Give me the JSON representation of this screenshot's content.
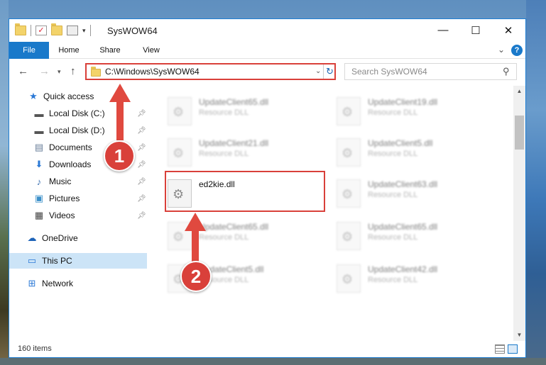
{
  "window": {
    "title": "SysWOW64",
    "controls": {
      "minimize": "—",
      "maximize": "☐",
      "close": "✕"
    }
  },
  "ribbon": {
    "tabs": [
      "File",
      "Home",
      "Share",
      "View"
    ],
    "help": "?"
  },
  "address": {
    "path": "C:\\Windows\\SysWOW64",
    "search_placeholder": "Search SysWOW64"
  },
  "nav": {
    "items": [
      {
        "label": "Quick access",
        "icon": "star-icon"
      },
      {
        "label": "Local Disk (C:)",
        "icon": "drive-icon",
        "pinned": true
      },
      {
        "label": "Local Disk (D:)",
        "icon": "drive-icon",
        "pinned": true
      },
      {
        "label": "Documents",
        "icon": "documents-icon",
        "pinned": true
      },
      {
        "label": "Downloads",
        "icon": "download-icon",
        "pinned": true
      },
      {
        "label": "Music",
        "icon": "music-icon",
        "pinned": true
      },
      {
        "label": "Pictures",
        "icon": "pictures-icon",
        "pinned": true
      },
      {
        "label": "Videos",
        "icon": "videos-icon",
        "pinned": true
      },
      {
        "label": "OneDrive",
        "icon": "cloud-icon"
      },
      {
        "label": "This PC",
        "icon": "computer-icon",
        "selected": true
      },
      {
        "label": "Network",
        "icon": "network-icon"
      }
    ]
  },
  "files": [
    {
      "name": "UpdateClient65.dll",
      "type": "Resource DLL",
      "blurred": true
    },
    {
      "name": "UpdateClient19.dll",
      "type": "Resource DLL",
      "blurred": true
    },
    {
      "name": "UpdateClient21.dll",
      "type": "Resource DLL",
      "blurred": true
    },
    {
      "name": "UpdateClient5.dll",
      "type": "Resource DLL",
      "blurred": true
    },
    {
      "name": "ed2kie.dll",
      "type": "",
      "blurred": false
    },
    {
      "name": "UpdateClient63.dll",
      "type": "Resource DLL",
      "blurred": true
    },
    {
      "name": "UpdateClient65.dll",
      "type": "Resource DLL",
      "blurred": true
    },
    {
      "name": "UpdateClient65.dll",
      "type": "Resource DLL",
      "blurred": true
    },
    {
      "name": "UpdateClient5.dll",
      "type": "Resource DLL",
      "blurred": true
    },
    {
      "name": "UpdateClient42.dll",
      "type": "Resource DLL",
      "blurred": true
    }
  ],
  "status": {
    "count": "160 items"
  },
  "annotations": {
    "step1": "1",
    "step2": "2",
    "color": "#d9403a"
  }
}
